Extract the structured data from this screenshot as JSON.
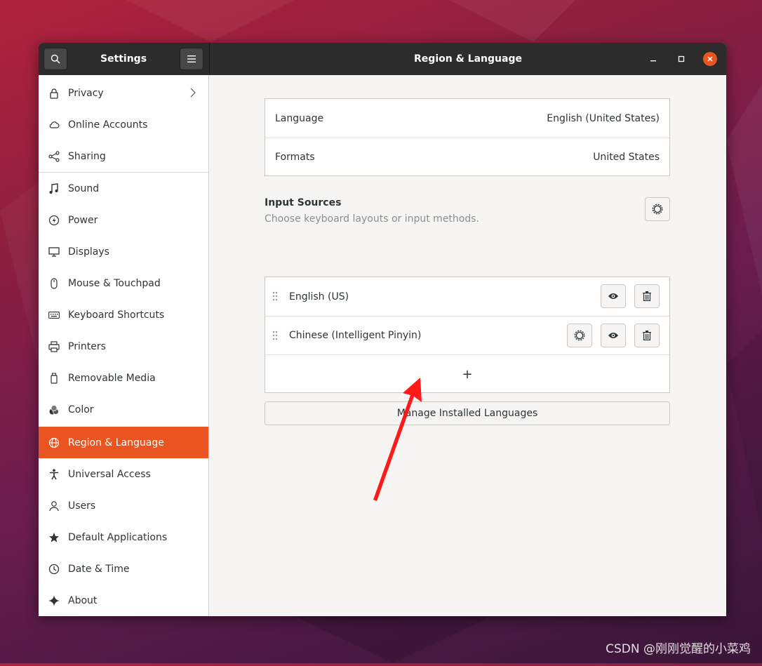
{
  "headerbar": {
    "sidebar_title": "Settings",
    "panel_title": "Region & Language"
  },
  "sidebar": {
    "items": [
      {
        "label": "Privacy",
        "icon": "lock-icon"
      },
      {
        "label": "Online Accounts",
        "icon": "cloud-icon"
      },
      {
        "label": "Sharing",
        "icon": "share-icon"
      },
      {
        "label": "Sound",
        "icon": "music-note-icon"
      },
      {
        "label": "Power",
        "icon": "power-icon"
      },
      {
        "label": "Displays",
        "icon": "display-icon"
      },
      {
        "label": "Mouse & Touchpad",
        "icon": "mouse-icon"
      },
      {
        "label": "Keyboard Shortcuts",
        "icon": "keyboard-icon"
      },
      {
        "label": "Printers",
        "icon": "printer-icon"
      },
      {
        "label": "Removable Media",
        "icon": "removable-media-icon"
      },
      {
        "label": "Color",
        "icon": "color-icon"
      },
      {
        "label": "Region & Language",
        "icon": "globe-icon",
        "active": true
      },
      {
        "label": "Universal Access",
        "icon": "accessibility-icon"
      },
      {
        "label": "Users",
        "icon": "users-icon"
      },
      {
        "label": "Default Applications",
        "icon": "star-icon"
      },
      {
        "label": "Date & Time",
        "icon": "clock-icon"
      },
      {
        "label": "About",
        "icon": "sparkle-icon"
      }
    ]
  },
  "region": {
    "language_label": "Language",
    "language_value": "English (United States)",
    "formats_label": "Formats",
    "formats_value": "United States"
  },
  "input_sources": {
    "title": "Input Sources",
    "subtitle": "Choose keyboard layouts or input methods.",
    "sources": [
      {
        "name": "English (US)"
      },
      {
        "name": "Chinese (Intelligent Pinyin)"
      }
    ],
    "add_symbol": "+"
  },
  "manage_button": "Manage Installed Languages",
  "watermark": "CSDN @刚刚觉醒的小菜鸡",
  "colors": {
    "accent": "#e95420",
    "headerbar": "#2c2c2c",
    "arrow": "#ff1a1a"
  }
}
